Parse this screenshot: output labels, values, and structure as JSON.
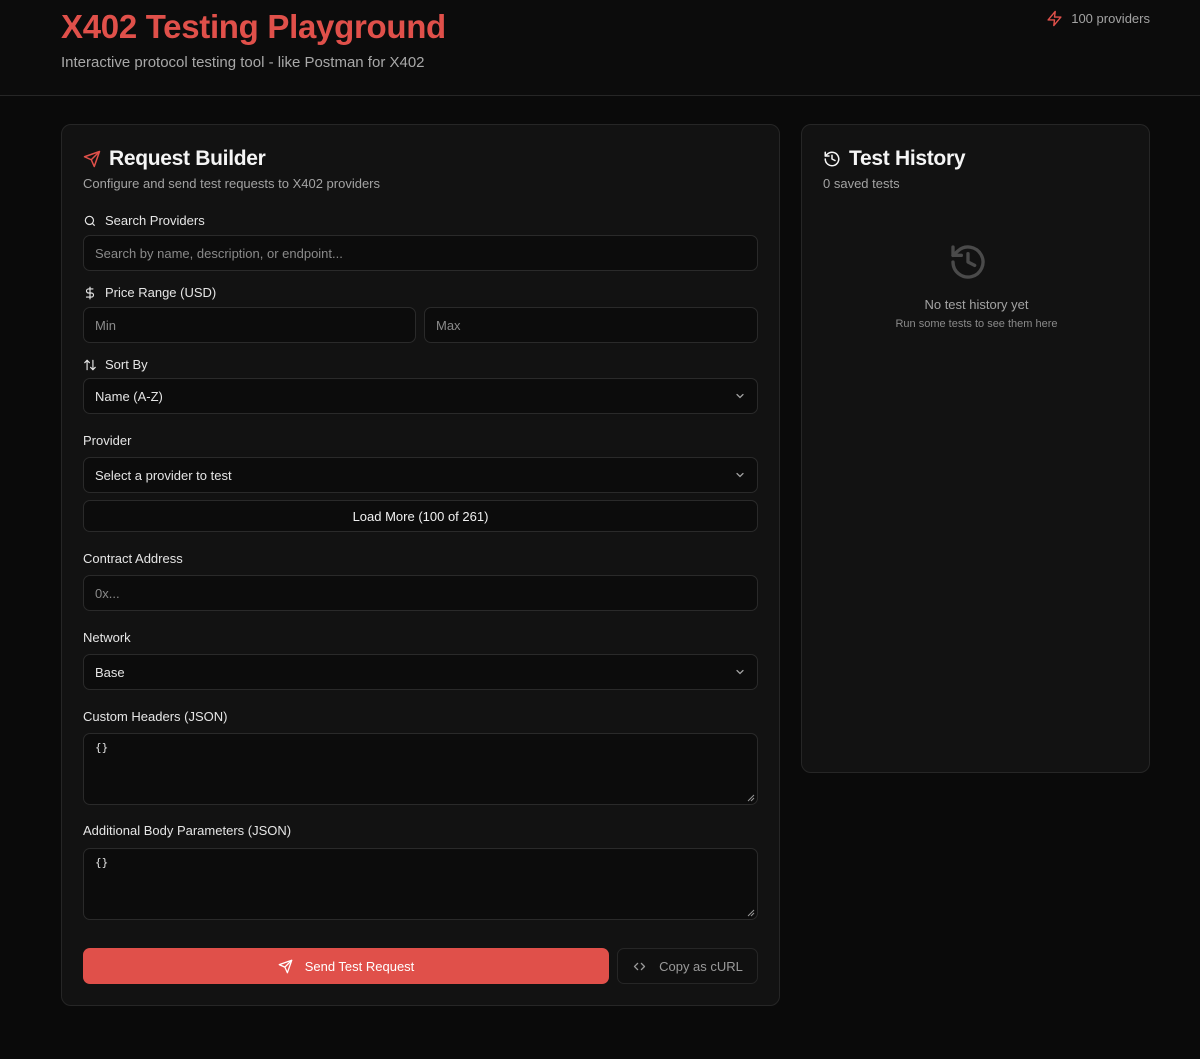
{
  "header": {
    "title": "X402 Testing Playground",
    "subtitle": "Interactive protocol testing tool - like Postman for X402",
    "provider_count": "100 providers"
  },
  "request_builder": {
    "title": "Request Builder",
    "description": "Configure and send test requests to X402 providers",
    "search": {
      "label": "Search Providers",
      "placeholder": "Search by name, description, or endpoint..."
    },
    "price_range": {
      "label": "Price Range (USD)",
      "min_placeholder": "Min",
      "max_placeholder": "Max"
    },
    "sort_by": {
      "label": "Sort By",
      "selected": "Name (A-Z)"
    },
    "provider": {
      "label": "Provider",
      "placeholder": "Select a provider to test",
      "load_more": "Load More (100 of 261)"
    },
    "contract_address": {
      "label": "Contract Address",
      "placeholder": "0x..."
    },
    "network": {
      "label": "Network",
      "selected": "Base"
    },
    "custom_headers": {
      "label": "Custom Headers (JSON)",
      "value": "{}"
    },
    "body_params": {
      "label": "Additional Body Parameters (JSON)",
      "value": "{}"
    },
    "send_button": "Send Test Request",
    "copy_button": "Copy as cURL"
  },
  "test_history": {
    "title": "Test History",
    "count": "0 saved tests",
    "empty_title": "No test history yet",
    "empty_subtitle": "Run some tests to see them here"
  },
  "colors": {
    "accent": "#e0504a",
    "background": "#0a0a0a",
    "card": "#121212",
    "border": "#262626"
  },
  "icons": [
    "zap-icon",
    "send-icon",
    "search-icon",
    "dollar-icon",
    "sort-icon",
    "chevron-down-icon",
    "history-icon",
    "code-icon"
  ]
}
